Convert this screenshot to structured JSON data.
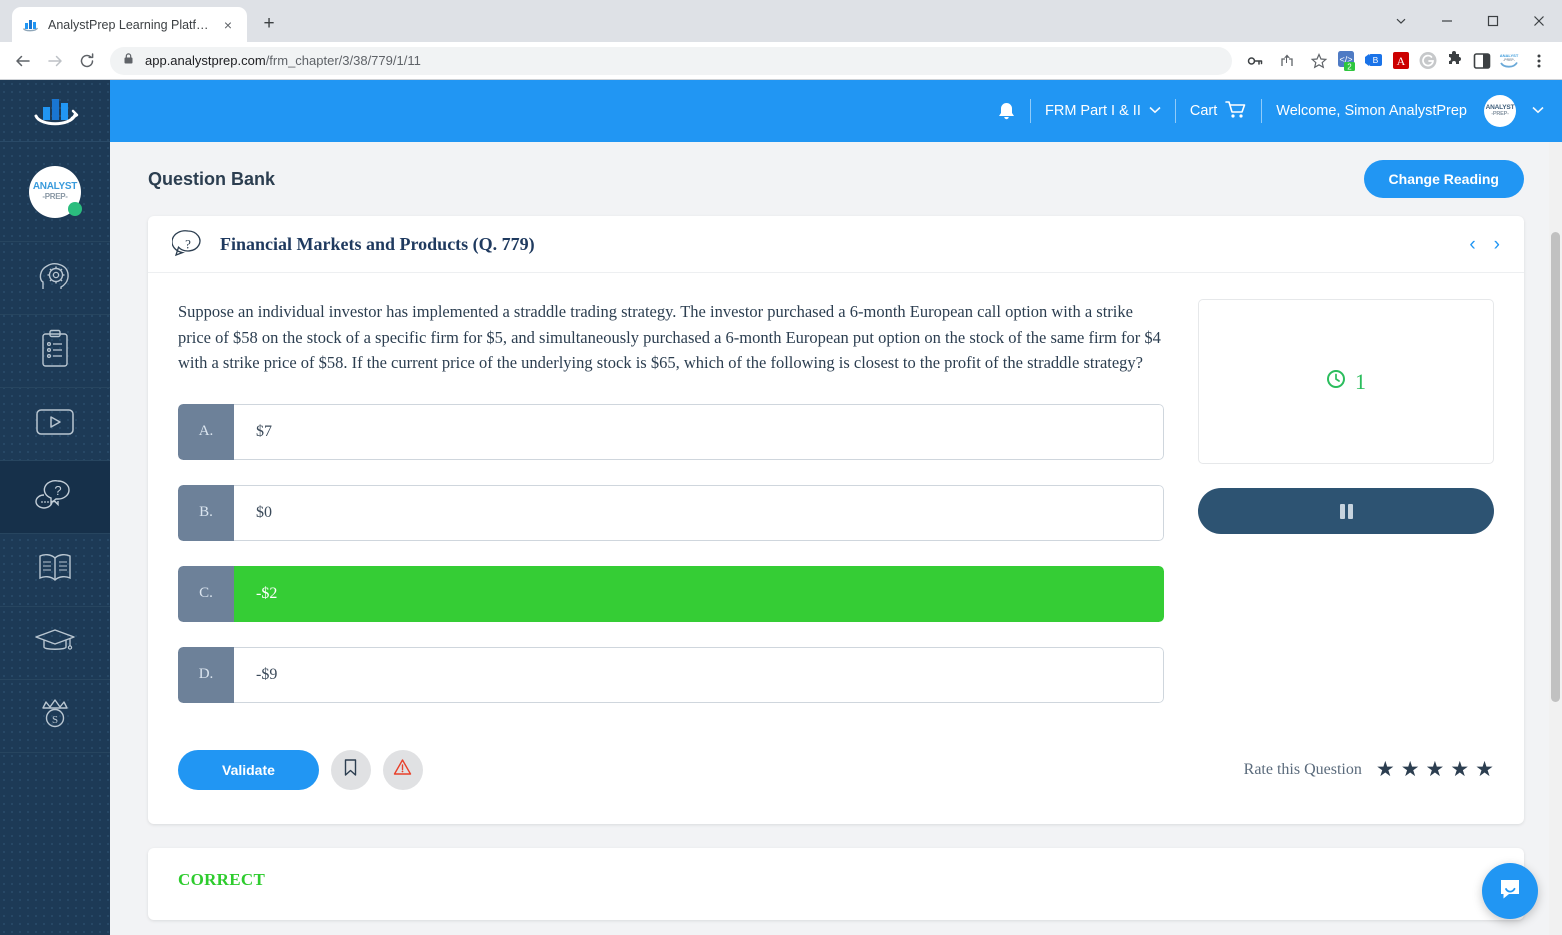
{
  "browser": {
    "tab": {
      "title": "AnalystPrep Learning Platform",
      "close_label": "×",
      "favicon": "barchart-favicon"
    },
    "newtab_label": "+",
    "url_host": "app.analystprep.com",
    "url_path": "/frm_chapter/3/38/779/1/11",
    "extensions": [
      "code-extension-icon",
      "translate-extension-icon",
      "adobe-acrobat-icon",
      "grammarly-icon",
      "puzzle-extensions-icon",
      "side-panel-icon",
      "analystprep-extension-icon"
    ],
    "extension_badge": "2",
    "window_controls": [
      "chevron-down",
      "minimize",
      "maximize",
      "close"
    ]
  },
  "topbar": {
    "notifications_icon": "bell-icon",
    "program": "FRM Part I & II",
    "cart": "Cart",
    "welcome": "Welcome, Simon AnalystPrep",
    "avatar_line1": "ANALYST",
    "avatar_line2": "-PREP-",
    "accent": "#2196f3"
  },
  "sidebar": {
    "logo": "analystprep-bars-logo",
    "avatar_line1": "ANALYST",
    "avatar_line2": "-PREP-",
    "items": [
      {
        "name": "brain-gear-icon",
        "label": "Study Planner"
      },
      {
        "name": "clipboard-icon",
        "label": "Practice Tests"
      },
      {
        "name": "video-play-icon",
        "label": "Video Lessons"
      },
      {
        "name": "question-chat-icon",
        "label": "Question Bank",
        "active": true
      },
      {
        "name": "open-book-icon",
        "label": "Study Notes"
      },
      {
        "name": "graduation-cap-icon",
        "label": "Courses"
      },
      {
        "name": "crown-icon",
        "label": "Premium"
      }
    ]
  },
  "header": {
    "title": "Question Bank",
    "change_reading_label": "Change Reading"
  },
  "question_card": {
    "icon": "question-mark-bubble-icon",
    "title": "Financial Markets and Products (Q. 779)",
    "prev_arrow": "‹",
    "next_arrow": "›",
    "text": "Suppose an individual investor has implemented a straddle trading strategy. The investor purchased a 6-month European call option with a strike price of $58 on the stock of a specific firm for $5, and simultaneously purchased a 6-month European put option on the stock of the same firm for $4 with a strike price of $58. If the current price of the underlying stock is $65, which of the following is closest to the profit of the straddle strategy?",
    "options": [
      {
        "letter": "A.",
        "text": "$7",
        "correct": false
      },
      {
        "letter": "B.",
        "text": "$0",
        "correct": false
      },
      {
        "letter": "C.",
        "text": "-$2",
        "correct": true
      },
      {
        "letter": "D.",
        "text": "-$9",
        "correct": false
      }
    ],
    "timer": {
      "icon": "clock-icon",
      "value": "1",
      "color": "#2bbd5d"
    },
    "pause_button": "pause-icon",
    "validate_label": "Validate",
    "bookmark_icon": "bookmark-icon",
    "report_icon": "report-warning-icon",
    "rate_label": "Rate this Question",
    "stars": [
      "★",
      "★",
      "★",
      "★",
      "★"
    ]
  },
  "result": {
    "status": "CORRECT",
    "color": "#2ecc2e"
  },
  "chat": {
    "icon": "chat-bubble-icon"
  }
}
